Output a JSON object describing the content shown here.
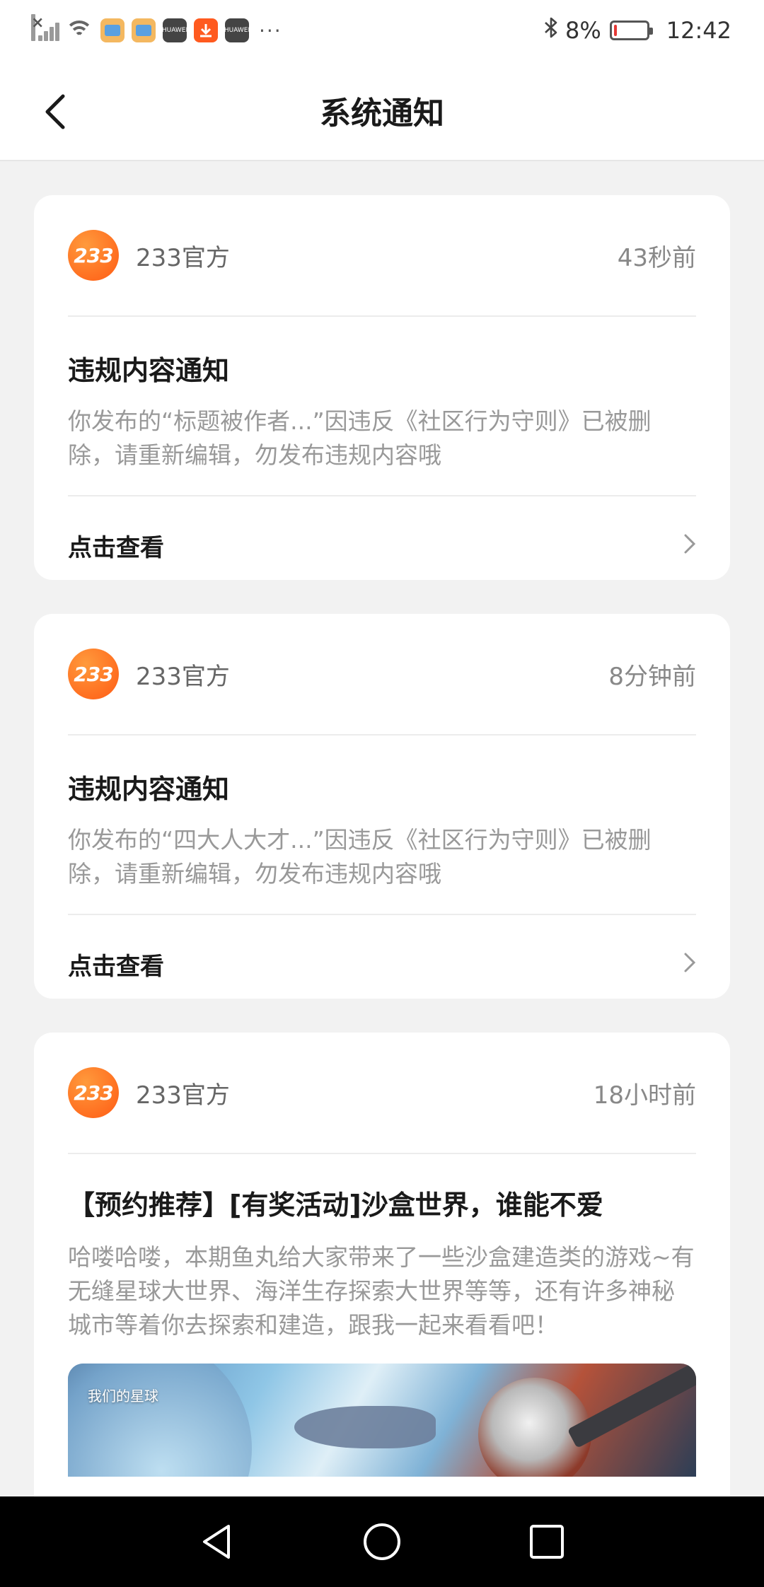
{
  "status_bar": {
    "battery": "8%",
    "battery_level": 0.08,
    "time": "12:42",
    "app_icon_text": "HUAWEI",
    "more": "···"
  },
  "header": {
    "title": "系统通知"
  },
  "notifications": [
    {
      "sender": "233官方",
      "logo_text": "233",
      "time": "43秒前",
      "title": "违规内容通知",
      "body": "你发布的“标题被作者...”因违反《社区行为守则》已被删除，请重新编辑，勿发布违规内容哦",
      "action": "点击查看"
    },
    {
      "sender": "233官方",
      "logo_text": "233",
      "time": "8分钟前",
      "title": "违规内容通知",
      "body": "你发布的“四大人大才...”因违反《社区行为守则》已被删除，请重新编辑，勿发布违规内容哦",
      "action": "点击查看"
    },
    {
      "sender": "233官方",
      "logo_text": "233",
      "time": "18小时前",
      "title": "【预约推荐】[有奖活动]沙盒世界，谁能不爱",
      "body": "哈喽哈喽，本期鱼丸给大家带来了一些沙盒建造类的游戏~有无缝星球大世界、海洋生存探索大世界等等，还有许多神秘城市等着你去探索和建造，跟我一起来看看吧！",
      "banner_brand": "我们的星球"
    }
  ],
  "colors": {
    "accent": "#ff6a1e",
    "background": "#f2f2f2",
    "battery_low": "#e53935"
  }
}
